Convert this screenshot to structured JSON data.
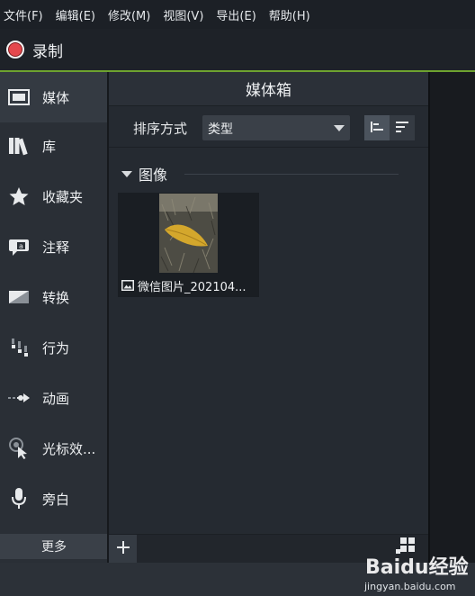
{
  "menu": [
    "文件(F)",
    "编辑(E)",
    "修改(M)",
    "视图(V)",
    "导出(E)",
    "帮助(H)"
  ],
  "record": {
    "label": "录制"
  },
  "sidebar": {
    "items": [
      {
        "label": "媒体",
        "icon": "film-strip-icon"
      },
      {
        "label": "库",
        "icon": "library-books-icon"
      },
      {
        "label": "收藏夹",
        "icon": "star-icon"
      },
      {
        "label": "注释",
        "icon": "callout-annotation-icon"
      },
      {
        "label": "转换",
        "icon": "transition-icon"
      },
      {
        "label": "行为",
        "icon": "behavior-icon"
      },
      {
        "label": "动画",
        "icon": "animation-arrow-icon"
      },
      {
        "label": "光标效...",
        "icon": "cursor-effect-icon"
      },
      {
        "label": "旁白",
        "icon": "microphone-icon"
      }
    ],
    "more_label": "更多"
  },
  "media_bin": {
    "title": "媒体箱",
    "sort_label": "排序方式",
    "sort_value": "类型",
    "section_title": "图像",
    "items": [
      {
        "name": "微信图片_202104...",
        "type_icon": "image-icon"
      }
    ]
  },
  "watermark": {
    "logo": "Baidu经验",
    "url": "jingyan.baidu.com"
  },
  "colors": {
    "record": "#e5484d",
    "accent_line": "#6ea32f",
    "sidebar_bg": "#2a2f36",
    "panel_bg": "#252a31"
  }
}
